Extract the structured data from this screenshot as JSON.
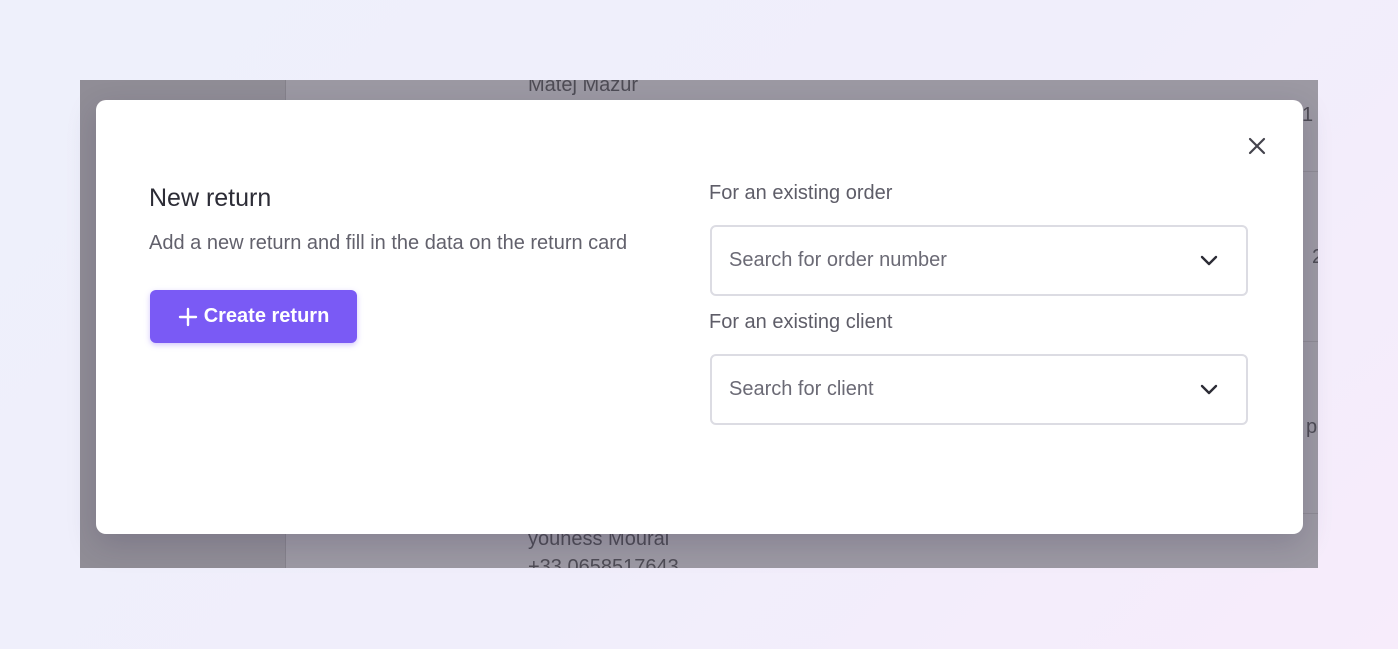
{
  "background": {
    "top_name": "Matej Mazur",
    "bottom_name": "youness Mourai",
    "bottom_phone": "+33 0658517643",
    "edge_chars": [
      "1",
      "2",
      "p"
    ]
  },
  "modal": {
    "title": "New return",
    "subtitle": "Add a new return and fill in the data on the return card",
    "create_button_label": "Create return",
    "order_label": "For an existing order",
    "order_placeholder": "Search for order number",
    "client_label": "For an existing client",
    "client_placeholder": "Search for client"
  },
  "icons": {
    "close": "close-icon",
    "plus": "plus-icon",
    "chevron": "chevron-down-icon"
  },
  "colors": {
    "accent": "#7a5af5",
    "overlay": "#9a97a0"
  }
}
